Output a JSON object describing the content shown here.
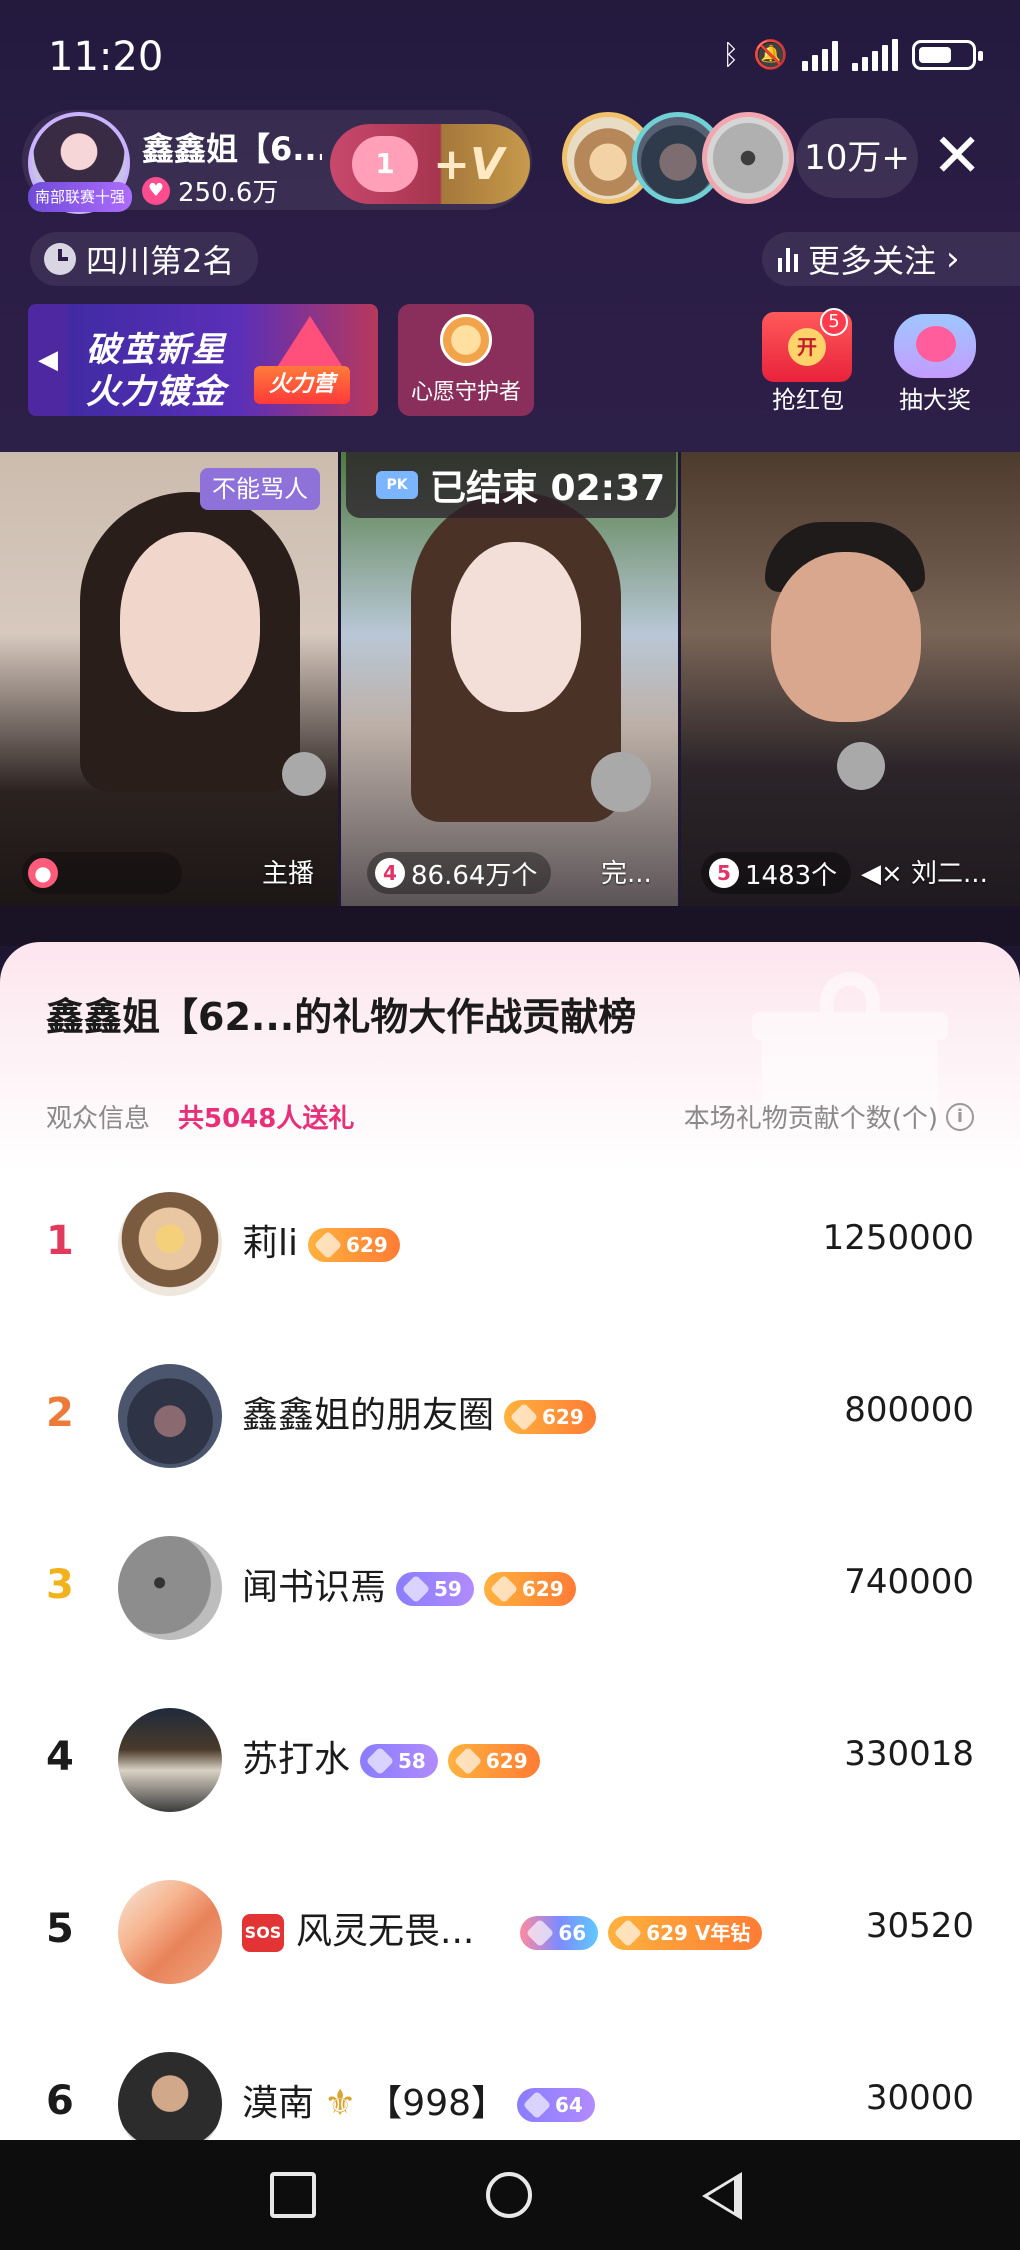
{
  "status": {
    "time": "11:20"
  },
  "host": {
    "name": "鑫鑫姐【6...",
    "likes": "250.6万",
    "badge": "南部联赛十强",
    "follow_level": "1"
  },
  "viewers": {
    "count": "10万+"
  },
  "header": {
    "rank": "四川第2名",
    "more_follow": "更多关注"
  },
  "banner": {
    "line1": "破茧新星",
    "line2": "火力镀金",
    "tag": "火力营"
  },
  "guard": {
    "label": "心愿守护者"
  },
  "redpack": {
    "label": "抢红包",
    "count": "5",
    "open": "开"
  },
  "lottery": {
    "label": "抽大奖"
  },
  "videos": {
    "ended": "已结束 02:37",
    "v1": {
      "tag": "不能骂人",
      "label": "主播"
    },
    "v2": {
      "rank": "4",
      "stat": "86.64万个",
      "label": "完..."
    },
    "v3": {
      "rank": "5",
      "stat": "1483个",
      "label": "刘二..."
    }
  },
  "panel": {
    "title": "鑫鑫姐【62...的礼物大作战贡献榜",
    "info_label": "观众信息",
    "gift_count": "共5048人送礼",
    "right_label": "本场礼物贡献个数(个)",
    "rows": [
      {
        "rank": "1",
        "name": "莉li",
        "badge1": "629",
        "score": "1250000",
        "rank_color": "#e23a5c"
      },
      {
        "rank": "2",
        "name": "鑫鑫姐的朋友圈",
        "badge1": "629",
        "score": "800000",
        "rank_color": "#ee7a3a"
      },
      {
        "rank": "3",
        "name": "闻书识焉",
        "badge0": "59",
        "badge1": "629",
        "score": "740000",
        "rank_color": "#f2b21c"
      },
      {
        "rank": "4",
        "name": "苏打水",
        "badge0": "58",
        "badge1": "629",
        "score": "330018"
      },
      {
        "rank": "5",
        "name": "风灵无畏...",
        "badge0": "66",
        "badge1": "629 V年钻",
        "score": "30520"
      },
      {
        "rank": "6",
        "name": "漠南",
        "suffix": "【998】",
        "badge0": "64",
        "score": "30000"
      }
    ]
  }
}
